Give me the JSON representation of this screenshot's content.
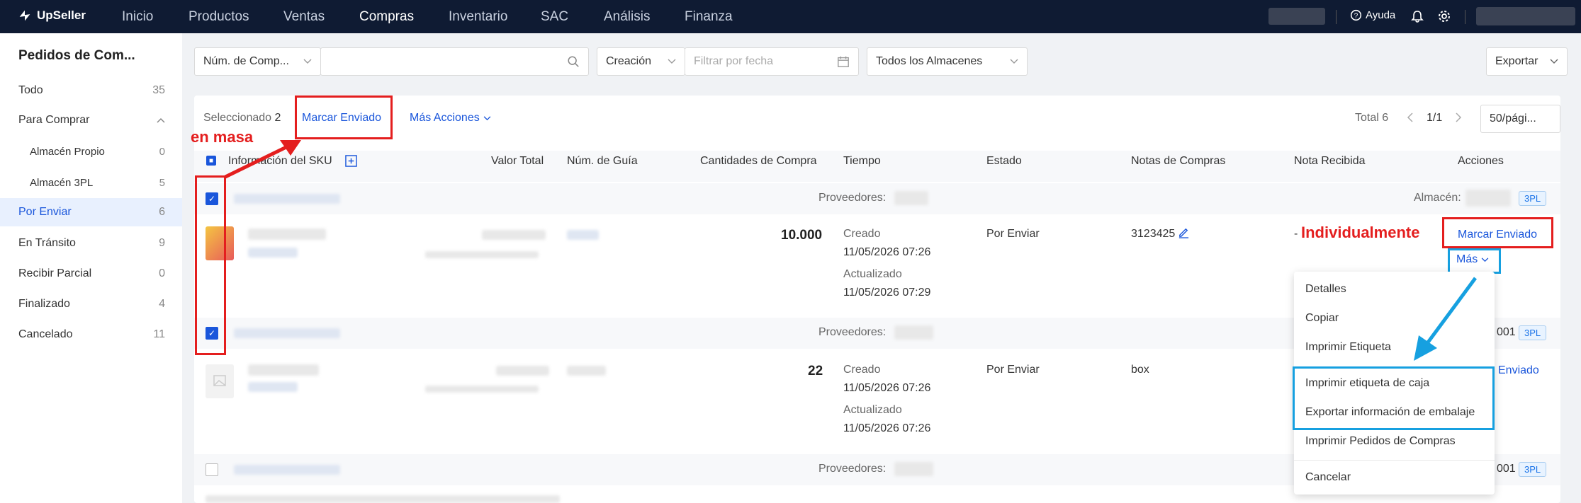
{
  "nav": {
    "logo": "UpSeller",
    "items": [
      "Inicio",
      "Productos",
      "Ventas",
      "Compras",
      "Inventario",
      "SAC",
      "Análisis",
      "Finanza"
    ],
    "help": "Ayuda"
  },
  "sidebar": {
    "title": "Pedidos de Com...",
    "items": [
      {
        "label": "Todo",
        "count": "35"
      },
      {
        "label": "Para Comprar",
        "count": "^"
      },
      {
        "label": "Almacén Propio",
        "count": "0"
      },
      {
        "label": "Almacén 3PL",
        "count": "5"
      },
      {
        "label": "Por Enviar",
        "count": "6"
      },
      {
        "label": "En Tránsito",
        "count": "9"
      },
      {
        "label": "Recibir Parcial",
        "count": "0"
      },
      {
        "label": "Finalizado",
        "count": "4"
      },
      {
        "label": "Cancelado",
        "count": "11"
      }
    ]
  },
  "filters": {
    "search_type": "Núm. de Comp...",
    "date_type": "Creación",
    "date_placeholder": "Filtrar por fecha",
    "warehouse": "Todos los Almacenes",
    "export": "Exportar"
  },
  "toolbar": {
    "selected_label": "Seleccionado",
    "selected_count": "2",
    "mark_sent": "Marcar Enviado",
    "more_actions": "Más Acciones",
    "total": "Total 6",
    "page": "1/1",
    "per_page": "50/pági..."
  },
  "columns": [
    "Información del SKU",
    "Valor Total",
    "Núm. de Guía",
    "Cantidades de Compra",
    "Tiempo",
    "Estado",
    "Notas de Compras",
    "Nota Recibida",
    "Acciones"
  ],
  "rows": [
    {
      "supplier_label": "Proveedores:",
      "warehouse_label": "Almacén:",
      "wh_tag": "3PL",
      "qty": "10.000",
      "created_label": "Creado",
      "created": "11/05/2026 07:26",
      "updated_label": "Actualizado",
      "updated": "11/05/2026 07:29",
      "status": "Por Enviar",
      "note": "3123425",
      "received": "-",
      "action_main": "Marcar Enviado",
      "action_more": "Más"
    },
    {
      "supplier_label": "Proveedores:",
      "wh_code": "001",
      "wh_tag": "3PL",
      "qty": "22",
      "created_label": "Creado",
      "created": "11/05/2026 07:26",
      "updated_label": "Actualizado",
      "updated": "11/05/2026 07:26",
      "status": "Por Enviar",
      "note": "box",
      "action_partial": "Enviado"
    },
    {
      "supplier_label": "Proveedores:",
      "wh_code": "001",
      "wh_tag": "3PL"
    }
  ],
  "menu": [
    "Detalles",
    "Copiar",
    "Imprimir Etiqueta",
    "Imprimir etiqueta de caja",
    "Exportar información de embalaje",
    "Imprimir Pedidos de Compras",
    "Cancelar"
  ],
  "annotations": {
    "bulk": "en masa",
    "individual": "Individualmente"
  }
}
